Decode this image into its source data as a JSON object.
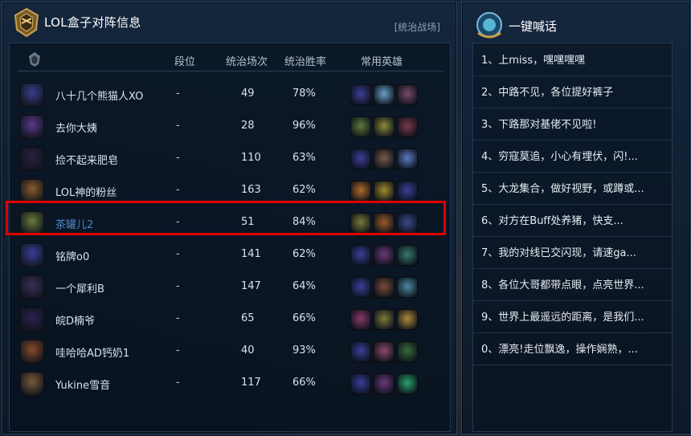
{
  "left_panel": {
    "title": "LOL盒子对阵信息",
    "mode_tag": "[统治战场]",
    "headers": {
      "rank": "段位",
      "games": "统治场次",
      "winrate": "统治胜率",
      "heroes": "常用英雄"
    },
    "players": [
      {
        "name": "八十几个熊猫人XO",
        "rank": "-",
        "games": "49",
        "winrate": "78%",
        "avatar_color": "#3a3f8c",
        "heroes": [
          "#3b3f9a",
          "#6a9fc9",
          "#7a4a6a"
        ]
      },
      {
        "name": "去你大姨",
        "rank": "-",
        "games": "28",
        "winrate": "96%",
        "avatar_color": "#5a3a8a",
        "heroes": [
          "#5d7a3a",
          "#8a8a3a",
          "#7a3a4a"
        ]
      },
      {
        "name": "捡不起来肥皂",
        "rank": "-",
        "games": "110",
        "winrate": "63%",
        "avatar_color": "#2a2040",
        "heroes": [
          "#3a3f9a",
          "#7a5a4a",
          "#5a7ac0"
        ]
      },
      {
        "name": "LOL神的粉丝",
        "rank": "-",
        "games": "163",
        "winrate": "62%",
        "avatar_color": "#8a5a2a",
        "heroes": [
          "#b06a2a",
          "#a08a2a",
          "#3a3f9a"
        ]
      },
      {
        "name": "茶罐儿2",
        "rank": "-",
        "games": "51",
        "winrate": "84%",
        "avatar_color": "#6a7a3a",
        "heroes": [
          "#7a7a3a",
          "#9a5a2a",
          "#3a4a8a"
        ],
        "highlighted": true
      },
      {
        "name": "铭牌o0",
        "rank": "-",
        "games": "141",
        "winrate": "62%",
        "avatar_color": "#3a3f9a",
        "heroes": [
          "#3a3f9a",
          "#6a3a7a",
          "#3a7a6a"
        ]
      },
      {
        "name": "一个犀利B",
        "rank": "-",
        "games": "147",
        "winrate": "64%",
        "avatar_color": "#3a2f5a",
        "heroes": [
          "#3a3f9a",
          "#7a4a3a",
          "#4a8aa0"
        ]
      },
      {
        "name": "皖D楠爷",
        "rank": "-",
        "games": "65",
        "winrate": "66%",
        "avatar_color": "#2a2050",
        "heroes": [
          "#8a3a6a",
          "#7a7a3a",
          "#b08a3a"
        ]
      },
      {
        "name": "哇哈哈AD钙奶1",
        "rank": "-",
        "games": "40",
        "winrate": "93%",
        "avatar_color": "#8a4a2a",
        "heroes": [
          "#3a3f9a",
          "#8a4a6a",
          "#3a6a3a"
        ]
      },
      {
        "name": "Yukine雪音",
        "rank": "-",
        "games": "117",
        "winrate": "66%",
        "avatar_color": "#7a5a3a",
        "heroes": [
          "#3a3f9a",
          "#6a3a7a",
          "#2aa06a"
        ]
      }
    ]
  },
  "right_panel": {
    "title": "一键喊话",
    "shouts": [
      "1、上miss，嘿嘿嘿嘿",
      "2、中路不见，各位提好裤子",
      "3、下路那对基佬不见啦!",
      "4、穷寇莫追，小心有埋伏，闪!...",
      "5、大龙集合，做好视野，或蹲或...",
      "6、对方在Buff处养猪，快支...",
      "7、我的对线已交闪现，请速ga...",
      "8、各位大哥都带点眼，点亮世界...",
      "9、世界上最遥远的距离，是我们...",
      "0、漂亮!走位飘逸，操作娴熟，..."
    ]
  },
  "colors": {
    "highlight": "#e00000",
    "accent_name": "#4f86c6"
  }
}
